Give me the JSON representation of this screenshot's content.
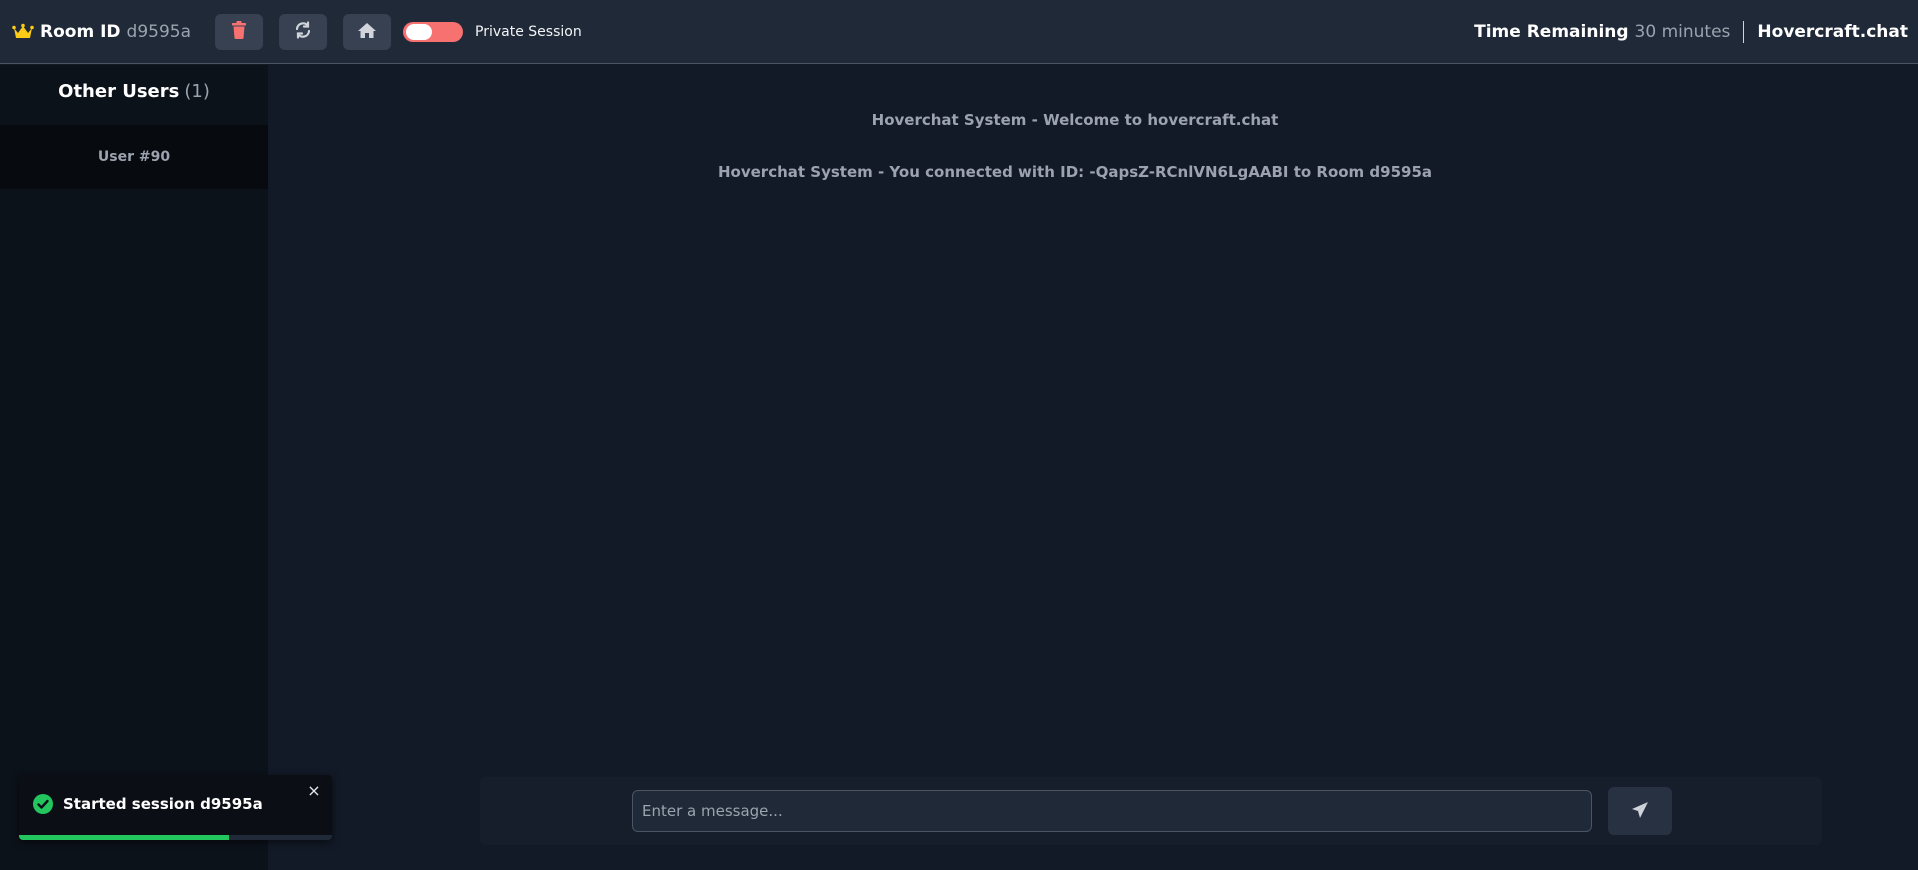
{
  "header": {
    "room_label": "Room ID",
    "room_id": "d9595a",
    "toggle_label": "Private Session",
    "toggle_on": false,
    "time_label": "Time Remaining",
    "time_value": "30 minutes",
    "brand": "Hovercraft.chat",
    "icons": {
      "crown": "crown-icon",
      "delete": "trash-icon",
      "refresh": "refresh-icon",
      "home": "home-icon"
    }
  },
  "sidebar": {
    "title": "Other Users",
    "count": "(1)",
    "users": [
      {
        "label": "User #90"
      }
    ]
  },
  "chat": {
    "messages": [
      {
        "text": "Hoverchat System - Welcome to hovercraft.chat"
      },
      {
        "text": "Hoverchat System - You connected with ID: -QapsZ-RCnlVN6LgAABI to Room d9595a"
      }
    ],
    "input_placeholder": "Enter a message...",
    "send_icon": "paper-plane-icon"
  },
  "toast": {
    "text": "Started session d9595a",
    "close": "×",
    "progress": 0.67,
    "icon": "check-circle-icon"
  },
  "colors": {
    "accent_danger": "#f87171",
    "success": "#22c55e",
    "crown": "#facc15",
    "topbar_bg": "#1f2937",
    "main_bg": "#131a27",
    "sidebar_bg": "#0c121a"
  }
}
